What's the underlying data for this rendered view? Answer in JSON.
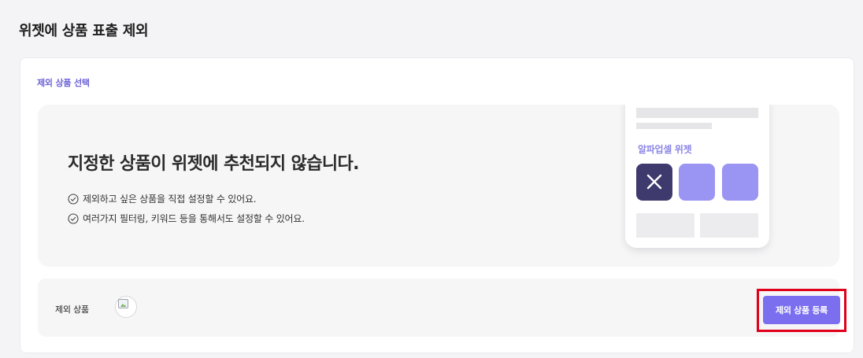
{
  "page": {
    "title": "위젯에 상품 표출 제외"
  },
  "section": {
    "label": "제외 상품 선택"
  },
  "banner": {
    "headline": "지정한 상품이 위젯에 추천되지 않습니다.",
    "features": [
      "제외하고 싶은 상품을 직접 설정할 수 있어요.",
      "여러가지 필터링, 키워드 등을 통해서도 설정할 수 있어요."
    ],
    "illustration": {
      "widget_title": "알파업셀 위젯",
      "excluded_tile_icon": "close-icon"
    }
  },
  "exclude_row": {
    "label": "제외 상품",
    "register_button": "제외 상품 등록"
  },
  "colors": {
    "accent": "#7b6ff0",
    "section_label": "#6b62d8",
    "highlight": "#e0001a",
    "tile_dark": "#3f3a6e",
    "tile_light": "#9a94f2"
  }
}
